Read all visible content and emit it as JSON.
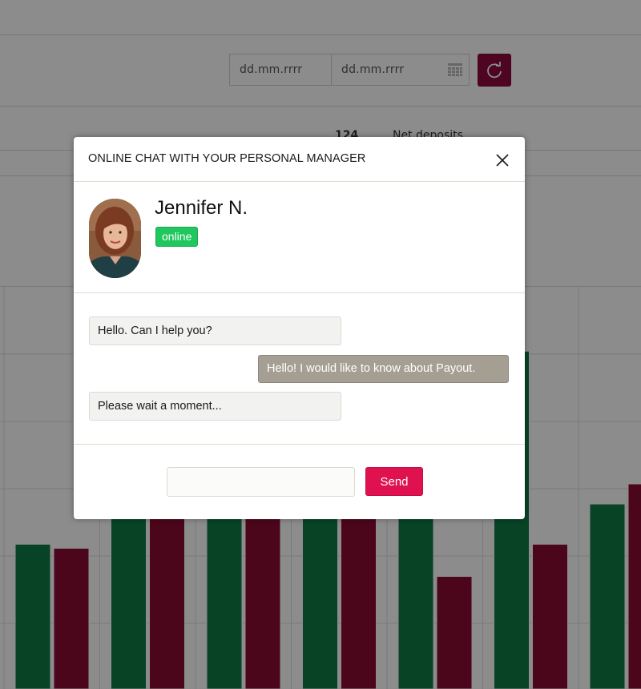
{
  "toolbar": {
    "date_from_placeholder": "dd.mm.rrrr",
    "date_to_placeholder": "dd.mm.rrrr",
    "calendar_icon": "calendar-icon",
    "refresh_icon": "refresh-icon"
  },
  "stats": {
    "value": "124",
    "label": "Net deposits"
  },
  "chart_data": {
    "type": "bar",
    "grid": true,
    "ylim": [
      0,
      10
    ],
    "series": [
      {
        "color": "#0f7a45",
        "values": [
          3.6,
          4.9,
          6.3,
          6.0,
          6.2,
          8.4,
          4.6
        ]
      },
      {
        "color": "#8a0c33",
        "values": [
          3.5,
          5.8,
          6.3,
          5.4,
          2.8,
          3.6,
          5.1
        ]
      }
    ]
  },
  "chat": {
    "title": "ONLINE CHAT WITH YOUR PERSONAL MANAGER",
    "close_icon": "close-icon",
    "manager": {
      "name": "Jennifer N.",
      "status": "online"
    },
    "messages": [
      {
        "from": "manager",
        "text": "Hello. Can I help you?"
      },
      {
        "from": "user",
        "text": "Hello! I would like to know about Payout."
      },
      {
        "from": "manager",
        "text": "Please wait a moment..."
      }
    ],
    "input_value": "",
    "send_label": "Send"
  },
  "colors": {
    "accent": "#e0114f",
    "online": "#1fc75e",
    "bar_green": "#0f7a45",
    "bar_red": "#8a0c33"
  }
}
